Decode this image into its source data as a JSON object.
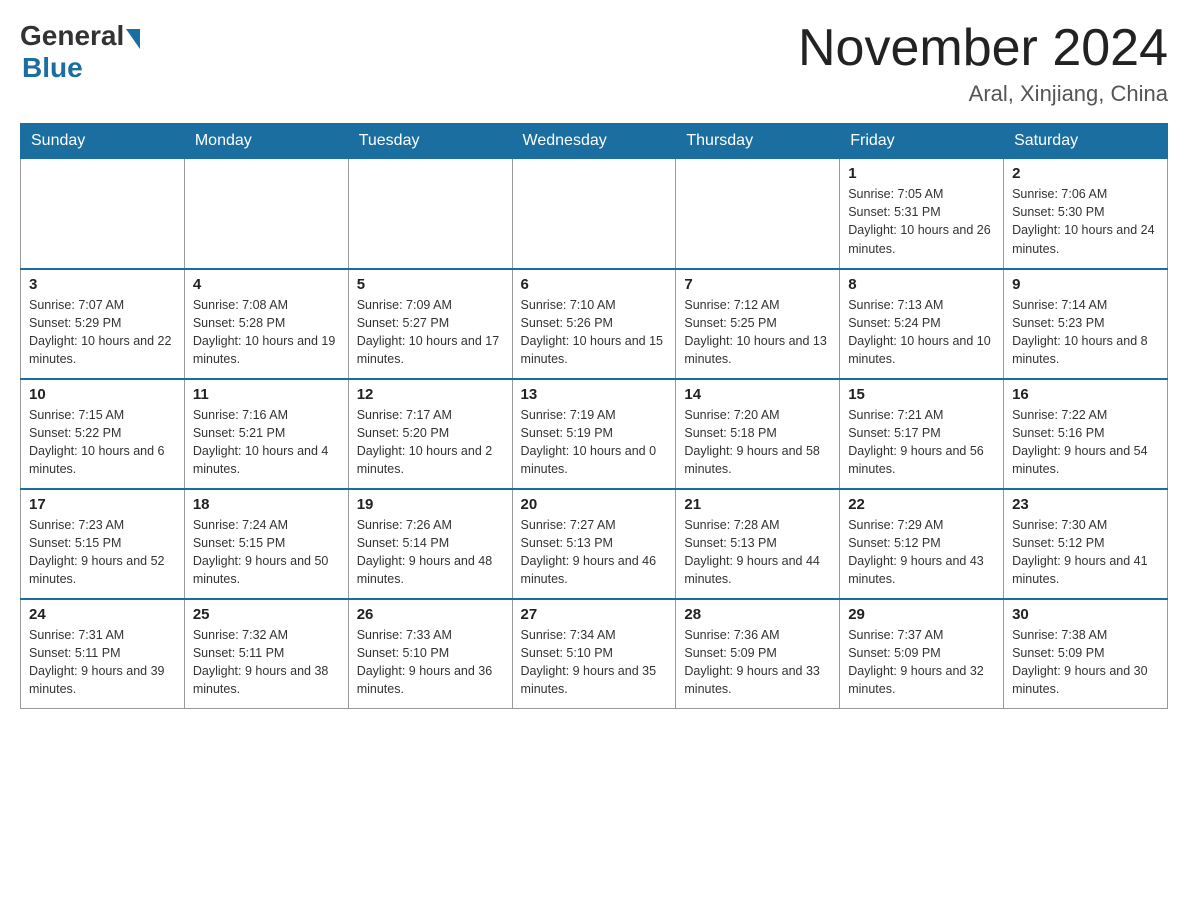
{
  "header": {
    "logo_general": "General",
    "logo_blue": "Blue",
    "month_title": "November 2024",
    "location": "Aral, Xinjiang, China"
  },
  "days_of_week": [
    "Sunday",
    "Monday",
    "Tuesday",
    "Wednesday",
    "Thursday",
    "Friday",
    "Saturday"
  ],
  "weeks": [
    [
      {
        "day": "",
        "sunrise": "",
        "sunset": "",
        "daylight": ""
      },
      {
        "day": "",
        "sunrise": "",
        "sunset": "",
        "daylight": ""
      },
      {
        "day": "",
        "sunrise": "",
        "sunset": "",
        "daylight": ""
      },
      {
        "day": "",
        "sunrise": "",
        "sunset": "",
        "daylight": ""
      },
      {
        "day": "",
        "sunrise": "",
        "sunset": "",
        "daylight": ""
      },
      {
        "day": "1",
        "sunrise": "Sunrise: 7:05 AM",
        "sunset": "Sunset: 5:31 PM",
        "daylight": "Daylight: 10 hours and 26 minutes."
      },
      {
        "day": "2",
        "sunrise": "Sunrise: 7:06 AM",
        "sunset": "Sunset: 5:30 PM",
        "daylight": "Daylight: 10 hours and 24 minutes."
      }
    ],
    [
      {
        "day": "3",
        "sunrise": "Sunrise: 7:07 AM",
        "sunset": "Sunset: 5:29 PM",
        "daylight": "Daylight: 10 hours and 22 minutes."
      },
      {
        "day": "4",
        "sunrise": "Sunrise: 7:08 AM",
        "sunset": "Sunset: 5:28 PM",
        "daylight": "Daylight: 10 hours and 19 minutes."
      },
      {
        "day": "5",
        "sunrise": "Sunrise: 7:09 AM",
        "sunset": "Sunset: 5:27 PM",
        "daylight": "Daylight: 10 hours and 17 minutes."
      },
      {
        "day": "6",
        "sunrise": "Sunrise: 7:10 AM",
        "sunset": "Sunset: 5:26 PM",
        "daylight": "Daylight: 10 hours and 15 minutes."
      },
      {
        "day": "7",
        "sunrise": "Sunrise: 7:12 AM",
        "sunset": "Sunset: 5:25 PM",
        "daylight": "Daylight: 10 hours and 13 minutes."
      },
      {
        "day": "8",
        "sunrise": "Sunrise: 7:13 AM",
        "sunset": "Sunset: 5:24 PM",
        "daylight": "Daylight: 10 hours and 10 minutes."
      },
      {
        "day": "9",
        "sunrise": "Sunrise: 7:14 AM",
        "sunset": "Sunset: 5:23 PM",
        "daylight": "Daylight: 10 hours and 8 minutes."
      }
    ],
    [
      {
        "day": "10",
        "sunrise": "Sunrise: 7:15 AM",
        "sunset": "Sunset: 5:22 PM",
        "daylight": "Daylight: 10 hours and 6 minutes."
      },
      {
        "day": "11",
        "sunrise": "Sunrise: 7:16 AM",
        "sunset": "Sunset: 5:21 PM",
        "daylight": "Daylight: 10 hours and 4 minutes."
      },
      {
        "day": "12",
        "sunrise": "Sunrise: 7:17 AM",
        "sunset": "Sunset: 5:20 PM",
        "daylight": "Daylight: 10 hours and 2 minutes."
      },
      {
        "day": "13",
        "sunrise": "Sunrise: 7:19 AM",
        "sunset": "Sunset: 5:19 PM",
        "daylight": "Daylight: 10 hours and 0 minutes."
      },
      {
        "day": "14",
        "sunrise": "Sunrise: 7:20 AM",
        "sunset": "Sunset: 5:18 PM",
        "daylight": "Daylight: 9 hours and 58 minutes."
      },
      {
        "day": "15",
        "sunrise": "Sunrise: 7:21 AM",
        "sunset": "Sunset: 5:17 PM",
        "daylight": "Daylight: 9 hours and 56 minutes."
      },
      {
        "day": "16",
        "sunrise": "Sunrise: 7:22 AM",
        "sunset": "Sunset: 5:16 PM",
        "daylight": "Daylight: 9 hours and 54 minutes."
      }
    ],
    [
      {
        "day": "17",
        "sunrise": "Sunrise: 7:23 AM",
        "sunset": "Sunset: 5:15 PM",
        "daylight": "Daylight: 9 hours and 52 minutes."
      },
      {
        "day": "18",
        "sunrise": "Sunrise: 7:24 AM",
        "sunset": "Sunset: 5:15 PM",
        "daylight": "Daylight: 9 hours and 50 minutes."
      },
      {
        "day": "19",
        "sunrise": "Sunrise: 7:26 AM",
        "sunset": "Sunset: 5:14 PM",
        "daylight": "Daylight: 9 hours and 48 minutes."
      },
      {
        "day": "20",
        "sunrise": "Sunrise: 7:27 AM",
        "sunset": "Sunset: 5:13 PM",
        "daylight": "Daylight: 9 hours and 46 minutes."
      },
      {
        "day": "21",
        "sunrise": "Sunrise: 7:28 AM",
        "sunset": "Sunset: 5:13 PM",
        "daylight": "Daylight: 9 hours and 44 minutes."
      },
      {
        "day": "22",
        "sunrise": "Sunrise: 7:29 AM",
        "sunset": "Sunset: 5:12 PM",
        "daylight": "Daylight: 9 hours and 43 minutes."
      },
      {
        "day": "23",
        "sunrise": "Sunrise: 7:30 AM",
        "sunset": "Sunset: 5:12 PM",
        "daylight": "Daylight: 9 hours and 41 minutes."
      }
    ],
    [
      {
        "day": "24",
        "sunrise": "Sunrise: 7:31 AM",
        "sunset": "Sunset: 5:11 PM",
        "daylight": "Daylight: 9 hours and 39 minutes."
      },
      {
        "day": "25",
        "sunrise": "Sunrise: 7:32 AM",
        "sunset": "Sunset: 5:11 PM",
        "daylight": "Daylight: 9 hours and 38 minutes."
      },
      {
        "day": "26",
        "sunrise": "Sunrise: 7:33 AM",
        "sunset": "Sunset: 5:10 PM",
        "daylight": "Daylight: 9 hours and 36 minutes."
      },
      {
        "day": "27",
        "sunrise": "Sunrise: 7:34 AM",
        "sunset": "Sunset: 5:10 PM",
        "daylight": "Daylight: 9 hours and 35 minutes."
      },
      {
        "day": "28",
        "sunrise": "Sunrise: 7:36 AM",
        "sunset": "Sunset: 5:09 PM",
        "daylight": "Daylight: 9 hours and 33 minutes."
      },
      {
        "day": "29",
        "sunrise": "Sunrise: 7:37 AM",
        "sunset": "Sunset: 5:09 PM",
        "daylight": "Daylight: 9 hours and 32 minutes."
      },
      {
        "day": "30",
        "sunrise": "Sunrise: 7:38 AM",
        "sunset": "Sunset: 5:09 PM",
        "daylight": "Daylight: 9 hours and 30 minutes."
      }
    ]
  ]
}
